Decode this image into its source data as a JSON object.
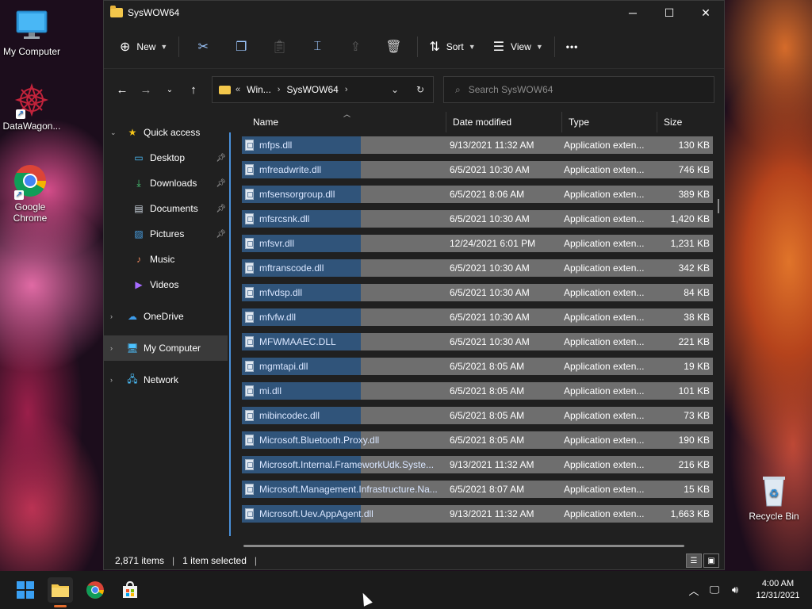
{
  "desktop": {
    "icons": [
      {
        "label": "My Computer"
      },
      {
        "label": "DataWagon..."
      },
      {
        "label": "Google Chrome"
      },
      {
        "label": "Recycle Bin"
      }
    ]
  },
  "window": {
    "title": "SysWOW64",
    "controls": {
      "minimize": "─",
      "maximize": "☐",
      "close": "✕"
    }
  },
  "toolbar": {
    "new_label": "New",
    "sort_label": "Sort",
    "view_label": "View",
    "more_label": "•••"
  },
  "address": {
    "overflow": "«",
    "segments": [
      "Win...",
      "SysWOW64"
    ],
    "search_placeholder": "Search SysWOW64"
  },
  "sidebar": {
    "items": [
      {
        "label": "Quick access",
        "icon": "star-icon"
      },
      {
        "label": "Desktop",
        "icon": "desktop-icon"
      },
      {
        "label": "Downloads",
        "icon": "download-icon"
      },
      {
        "label": "Documents",
        "icon": "document-icon"
      },
      {
        "label": "Pictures",
        "icon": "pictures-icon"
      },
      {
        "label": "Music",
        "icon": "music-icon"
      },
      {
        "label": "Videos",
        "icon": "videos-icon"
      },
      {
        "label": "OneDrive",
        "icon": "cloud-icon"
      },
      {
        "label": "My Computer",
        "icon": "computer-icon"
      },
      {
        "label": "Network",
        "icon": "network-icon"
      }
    ]
  },
  "columns": {
    "name": "Name",
    "date": "Date modified",
    "type": "Type",
    "size": "Size"
  },
  "files": [
    {
      "name": "mfps.dll",
      "date": "9/13/2021 11:32 AM",
      "type": "Application exten...",
      "size": "130 KB"
    },
    {
      "name": "mfreadwrite.dll",
      "date": "6/5/2021 10:30 AM",
      "type": "Application exten...",
      "size": "746 KB"
    },
    {
      "name": "mfsensorgroup.dll",
      "date": "6/5/2021 8:06 AM",
      "type": "Application exten...",
      "size": "389 KB"
    },
    {
      "name": "mfsrcsnk.dll",
      "date": "6/5/2021 10:30 AM",
      "type": "Application exten...",
      "size": "1,420 KB"
    },
    {
      "name": "mfsvr.dll",
      "date": "12/24/2021 6:01 PM",
      "type": "Application exten...",
      "size": "1,231 KB"
    },
    {
      "name": "mftranscode.dll",
      "date": "6/5/2021 10:30 AM",
      "type": "Application exten...",
      "size": "342 KB"
    },
    {
      "name": "mfvdsp.dll",
      "date": "6/5/2021 10:30 AM",
      "type": "Application exten...",
      "size": "84 KB"
    },
    {
      "name": "mfvfw.dll",
      "date": "6/5/2021 10:30 AM",
      "type": "Application exten...",
      "size": "38 KB"
    },
    {
      "name": "MFWMAAEC.DLL",
      "date": "6/5/2021 10:30 AM",
      "type": "Application exten...",
      "size": "221 KB"
    },
    {
      "name": "mgmtapi.dll",
      "date": "6/5/2021 8:05 AM",
      "type": "Application exten...",
      "size": "19 KB"
    },
    {
      "name": "mi.dll",
      "date": "6/5/2021 8:05 AM",
      "type": "Application exten...",
      "size": "101 KB"
    },
    {
      "name": "mibincodec.dll",
      "date": "6/5/2021 8:05 AM",
      "type": "Application exten...",
      "size": "73 KB"
    },
    {
      "name": "Microsoft.Bluetooth.Proxy.dll",
      "date": "6/5/2021 8:05 AM",
      "type": "Application exten...",
      "size": "190 KB"
    },
    {
      "name": "Microsoft.Internal.FrameworkUdk.Syste...",
      "date": "9/13/2021 11:32 AM",
      "type": "Application exten...",
      "size": "216 KB"
    },
    {
      "name": "Microsoft.Management.Infrastructure.Na...",
      "date": "6/5/2021 8:07 AM",
      "type": "Application exten...",
      "size": "15 KB"
    },
    {
      "name": "Microsoft.Uev.AppAgent.dll",
      "date": "9/13/2021 11:32 AM",
      "type": "Application exten...",
      "size": "1,663 KB"
    }
  ],
  "status": {
    "items": "2,871 items",
    "selected": "1 item selected"
  },
  "taskbar": {
    "time": "4:00 AM",
    "date": "12/31/2021"
  }
}
